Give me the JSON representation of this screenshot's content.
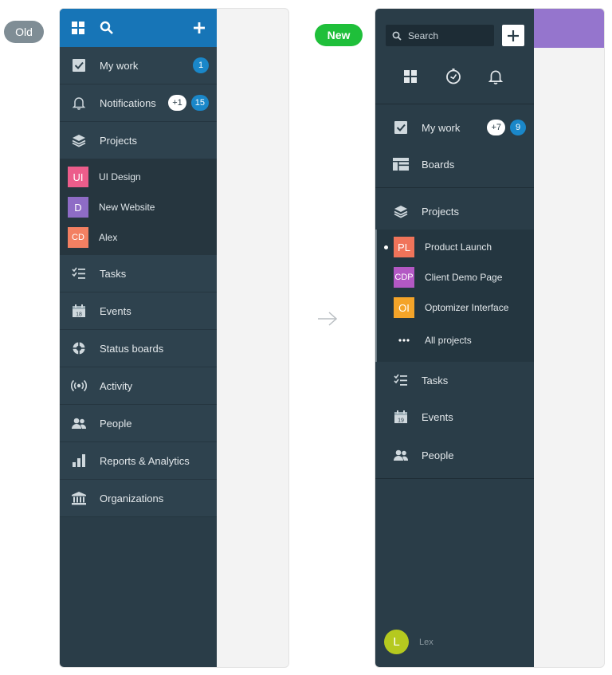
{
  "labels": {
    "old": "Old",
    "new": "New"
  },
  "colors": {
    "old_header": "#1775b7",
    "sidebar": "#2a3d48",
    "badge_blue": "#1a87c9",
    "new_pill": "#1fbf3a",
    "new_topbar": "#9575cd"
  },
  "old_sidebar": {
    "header_icons": [
      "grid-icon",
      "search-icon",
      "plus-icon"
    ],
    "items_top": [
      {
        "label": "My work",
        "icon": "checkbox-icon",
        "badge": "1"
      },
      {
        "label": "Notifications",
        "icon": "bell-icon",
        "extra": "+1",
        "badge": "15"
      },
      {
        "label": "Projects",
        "icon": "layers-icon"
      }
    ],
    "projects": [
      {
        "initials": "UI",
        "name": "UI Design",
        "color": "#ec5d8b"
      },
      {
        "initials": "D",
        "name": "New Website",
        "color": "#8e6cc6"
      },
      {
        "initials": "CD",
        "name": "Alex",
        "color": "#f38062"
      }
    ],
    "items_bottom": [
      {
        "label": "Tasks",
        "icon": "tasks-icon"
      },
      {
        "label": "Events",
        "icon": "calendar-icon"
      },
      {
        "label": "Status boards",
        "icon": "target-icon"
      },
      {
        "label": "Activity",
        "icon": "broadcast-icon"
      },
      {
        "label": "People",
        "icon": "people-icon"
      },
      {
        "label": "Reports & Analytics",
        "icon": "bar-chart-icon"
      },
      {
        "label": "Organizations",
        "icon": "bank-icon"
      }
    ]
  },
  "new_sidebar": {
    "search_placeholder": "Search",
    "icon_row": [
      "grid-icon",
      "clock-icon",
      "bell-icon"
    ],
    "my_work": {
      "label": "My work",
      "extra": "+7",
      "badge": "9"
    },
    "boards": {
      "label": "Boards"
    },
    "projects": {
      "label": "Projects"
    },
    "project_list": [
      {
        "initials": "PL",
        "name": "Product Launch",
        "color": "#f0745a",
        "active": true
      },
      {
        "initials": "CDP",
        "name": "Client Demo Page",
        "color": "#b358c4",
        "active": false
      },
      {
        "initials": "OI",
        "name": "Optomizer Interface",
        "color": "#f4a429",
        "active": false
      }
    ],
    "all_projects": "All projects",
    "items": [
      {
        "label": "Tasks",
        "icon": "tasks-icon"
      },
      {
        "label": "Events",
        "icon": "calendar-icon"
      },
      {
        "label": "People",
        "icon": "people-icon"
      }
    ],
    "user": {
      "initial": "L",
      "name": "Lex"
    }
  }
}
